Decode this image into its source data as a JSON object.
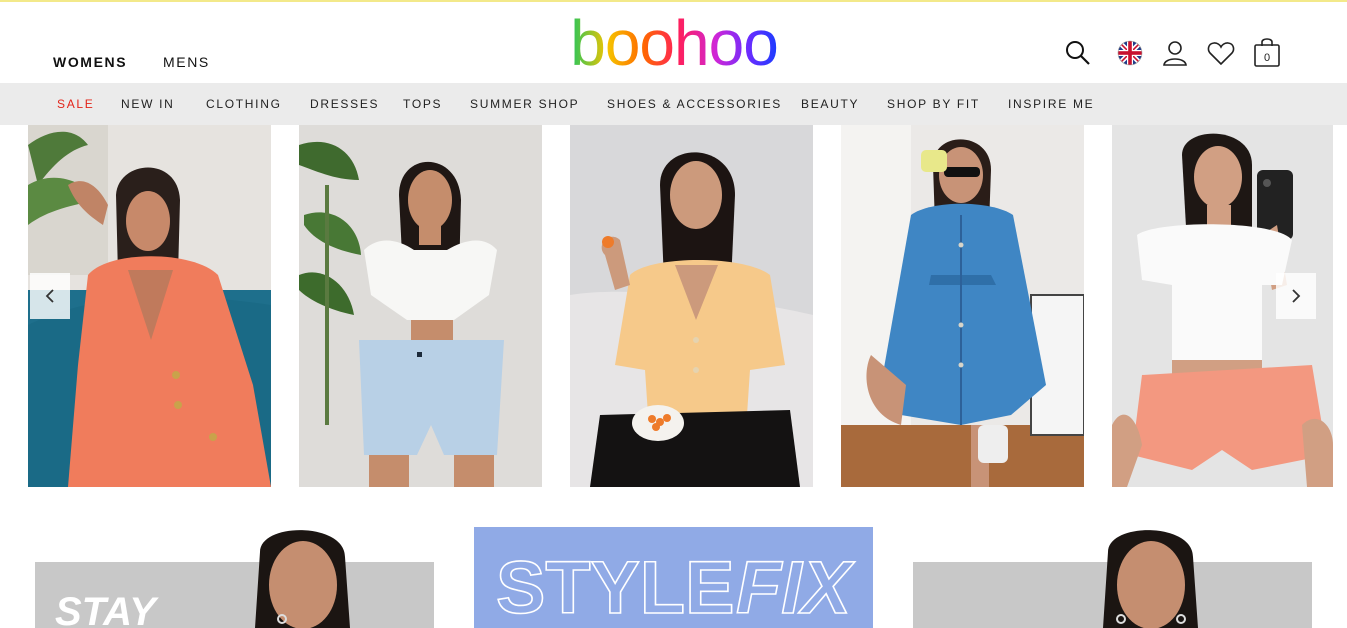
{
  "header": {
    "genders": [
      "WOMENS",
      "MENS"
    ],
    "logo_text": "boohoo",
    "bag_count": "0",
    "icons": [
      "search-icon",
      "uk-flag-icon",
      "account-icon",
      "wishlist-heart-icon",
      "shopping-bag-icon"
    ]
  },
  "nav": {
    "items": [
      "SALE",
      "NEW IN",
      "CLOTHING",
      "DRESSES",
      "TOPS",
      "SUMMER SHOP",
      "SHOES & ACCESSORIES",
      "BEAUTY",
      "SHOP BY FIT",
      "INSPIRE ME"
    ],
    "sale_color": "#e2241a"
  },
  "carousel": {
    "controls": [
      "chevron-left-icon",
      "chevron-right-icon"
    ],
    "products": [
      {
        "name": "coral blazer dress"
      },
      {
        "name": "white puff sleeve crop top and blue shorts"
      },
      {
        "name": "peach knit shirt and black cycling shorts"
      },
      {
        "name": "denim button front dress"
      },
      {
        "name": "white crop tee and coral shorts"
      }
    ]
  },
  "banners": {
    "left_text": "STAY",
    "middle_text_a": "STYLE",
    "middle_text_b": "FIX",
    "middle_bg": "#8aa6e4"
  }
}
